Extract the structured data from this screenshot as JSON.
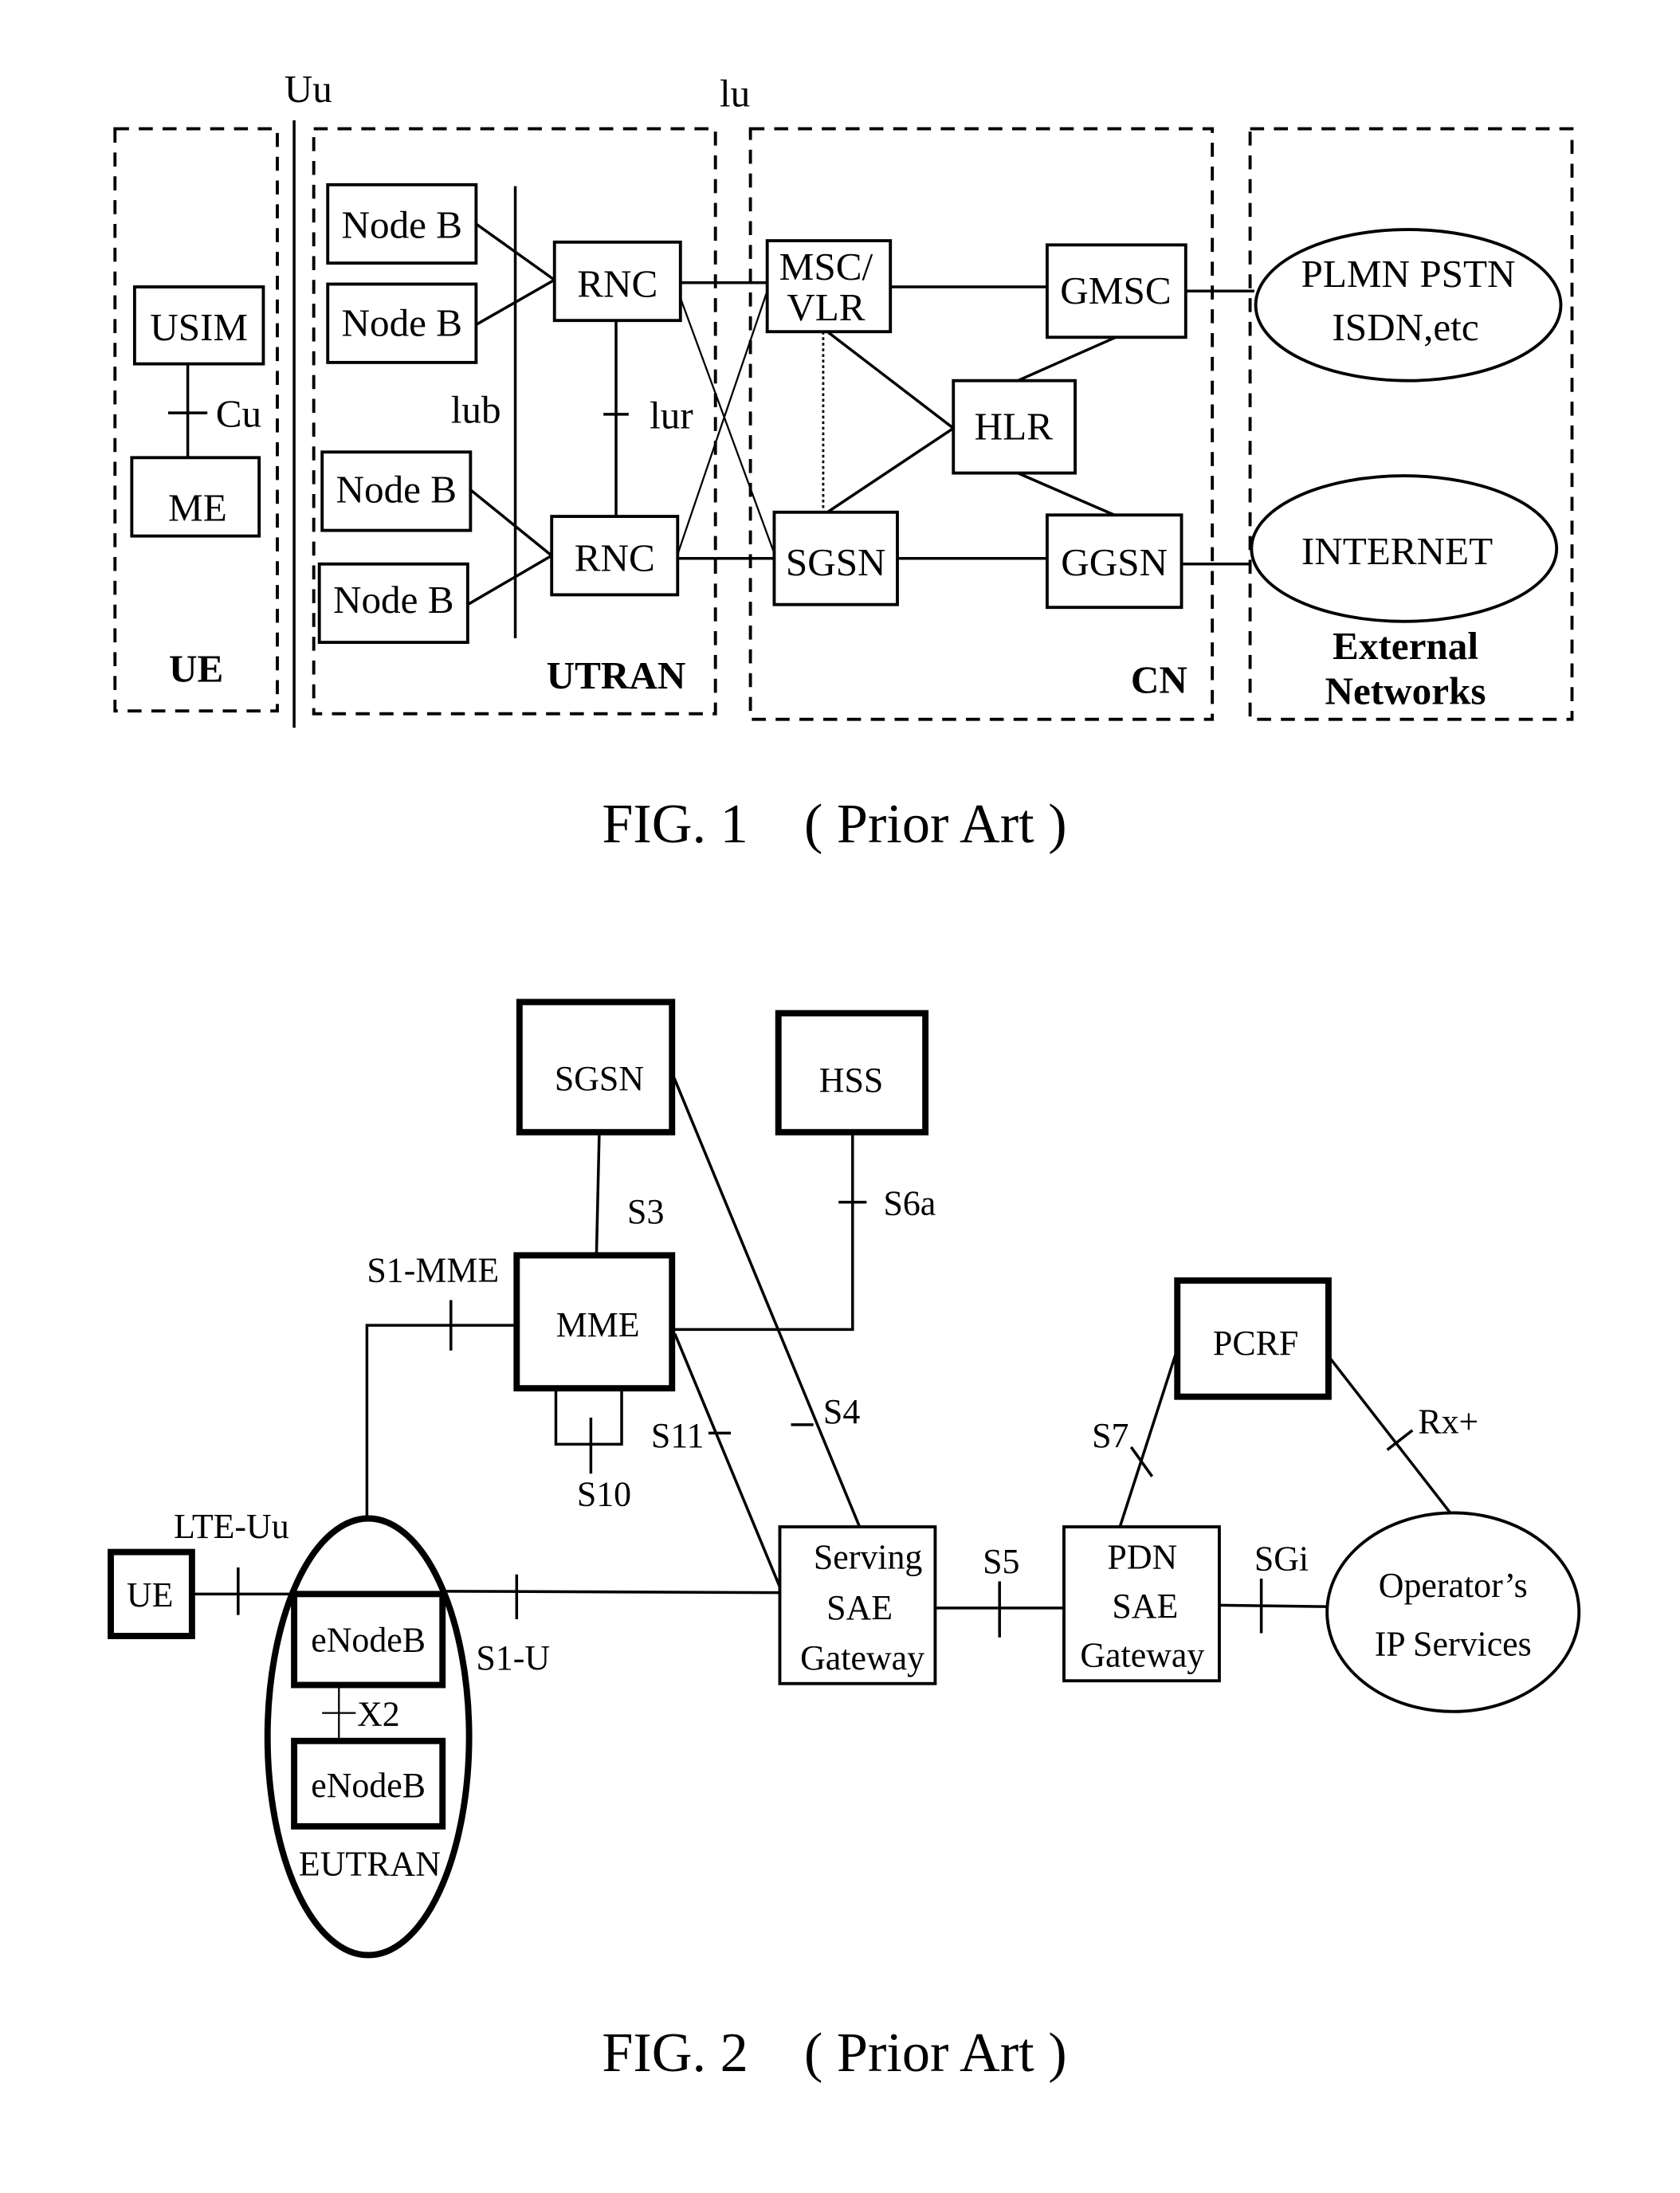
{
  "fig1": {
    "caption": "FIG. 1　( Prior Art )",
    "interfaces": {
      "uu": "Uu",
      "iu": "lu",
      "cu": "Cu",
      "iub": "lub",
      "iur": "lur"
    },
    "domains": {
      "ue": "UE",
      "utran": "UTRAN",
      "cn": "CN",
      "ext_line1": "External",
      "ext_line2": "Networks"
    },
    "nodes": {
      "usim": "USIM",
      "me": "ME",
      "nodeb1": "Node B",
      "nodeb2": "Node B",
      "nodeb3": "Node B",
      "nodeb4": "Node B",
      "rnc1": "RNC",
      "rnc2": "RNC",
      "msc_line1": "MSC/",
      "msc_line2": "VLR",
      "gmsc": "GMSC",
      "hlr": "HLR",
      "sgsn": "SGSN",
      "ggsn": "GGSN",
      "plmn_line1": "PLMN PSTN",
      "plmn_line2": "ISDN,etc",
      "internet": "INTERNET"
    }
  },
  "fig2": {
    "caption": "FIG. 2　( Prior Art )",
    "nodes": {
      "sgsn": "SGSN",
      "hss": "HSS",
      "mme": "MME",
      "pcrf": "PCRF",
      "ue": "UE",
      "enodeb1": "eNodeB",
      "enodeb2": "eNodeB",
      "eutran": "EUTRAN",
      "sgw_line1": "Serving",
      "sgw_line2": "SAE",
      "sgw_line3": "Gateway",
      "pgw_line1": "PDN",
      "pgw_line2": "SAE",
      "pgw_line3": "Gateway",
      "ops_line1": "Operator’s",
      "ops_line2": "IP Services"
    },
    "interfaces": {
      "s3": "S3",
      "s6a": "S6a",
      "s1mme": "S1-MME",
      "s10": "S10",
      "s11": "S11",
      "s4": "S4",
      "s7": "S7",
      "rx": "Rx+",
      "lteuu": "LTE-Uu",
      "s1u": "S1-U",
      "x2": "X2",
      "s5": "S5",
      "sgi": "SGi"
    }
  }
}
